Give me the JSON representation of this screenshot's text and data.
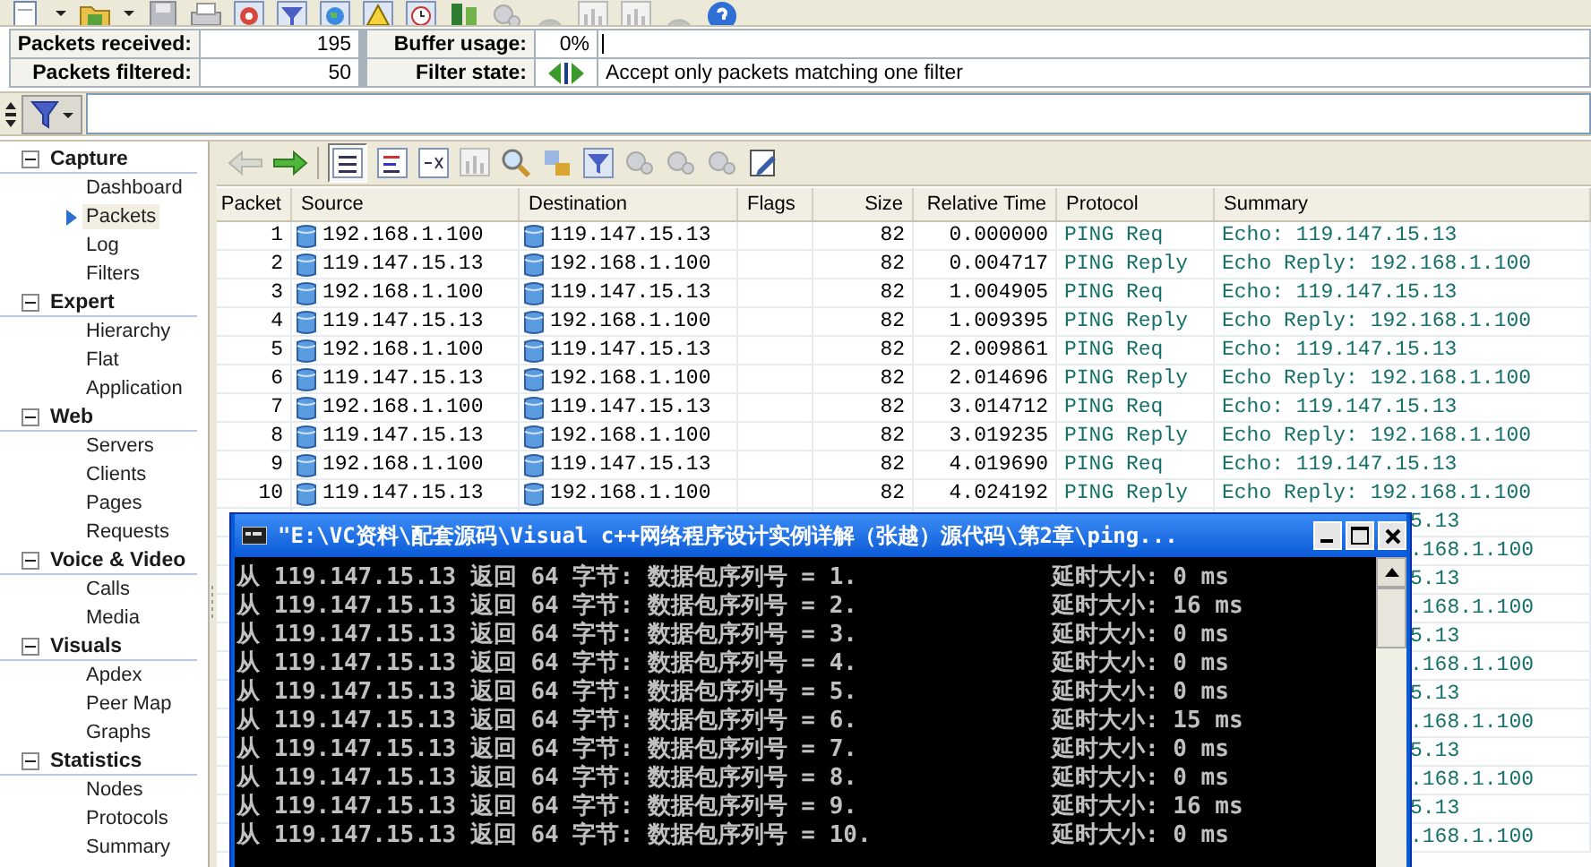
{
  "stats": {
    "received": {
      "label": "Packets received:",
      "value": "195"
    },
    "filtered": {
      "label": "Packets filtered:",
      "value": "50"
    },
    "buffer": {
      "label": "Buffer usage:",
      "value": "0%",
      "level": 0
    },
    "filter_state": {
      "label": "Filter state:",
      "text": "Accept only packets matching one filter"
    }
  },
  "sidebar": {
    "groups": [
      {
        "label": "Capture",
        "expanded": true,
        "children": [
          {
            "label": "Dashboard",
            "selected": false
          },
          {
            "label": "Packets",
            "selected": true
          },
          {
            "label": "Log",
            "selected": false
          },
          {
            "label": "Filters",
            "selected": false
          }
        ]
      },
      {
        "label": "Expert",
        "expanded": true,
        "children": [
          {
            "label": "Hierarchy",
            "selected": false
          },
          {
            "label": "Flat",
            "selected": false
          },
          {
            "label": "Application",
            "selected": false
          }
        ]
      },
      {
        "label": "Web",
        "expanded": true,
        "children": [
          {
            "label": "Servers",
            "selected": false
          },
          {
            "label": "Clients",
            "selected": false
          },
          {
            "label": "Pages",
            "selected": false
          },
          {
            "label": "Requests",
            "selected": false
          }
        ]
      },
      {
        "label": "Voice & Video",
        "expanded": true,
        "children": [
          {
            "label": "Calls",
            "selected": false
          },
          {
            "label": "Media",
            "selected": false
          }
        ]
      },
      {
        "label": "Visuals",
        "expanded": true,
        "children": [
          {
            "label": "Apdex",
            "selected": false
          },
          {
            "label": "Peer Map",
            "selected": false
          },
          {
            "label": "Graphs",
            "selected": false
          }
        ]
      },
      {
        "label": "Statistics",
        "expanded": true,
        "children": [
          {
            "label": "Nodes",
            "selected": false
          },
          {
            "label": "Protocols",
            "selected": false
          },
          {
            "label": "Summary",
            "selected": false
          }
        ]
      }
    ]
  },
  "packets": {
    "columns": [
      "Packet",
      "Source",
      "Destination",
      "Flags",
      "Size",
      "Relative Time",
      "Protocol",
      "Summary"
    ],
    "rows": [
      {
        "packet": "1",
        "source": "192.168.1.100",
        "destination": "119.147.15.13",
        "size": "82",
        "time": "0.000000",
        "protocol": "PING Req",
        "summary": "Echo: 119.147.15.13"
      },
      {
        "packet": "2",
        "source": "119.147.15.13",
        "destination": "192.168.1.100",
        "size": "82",
        "time": "0.004717",
        "protocol": "PING Reply",
        "summary": "Echo Reply: 192.168.1.100"
      },
      {
        "packet": "3",
        "source": "192.168.1.100",
        "destination": "119.147.15.13",
        "size": "82",
        "time": "1.004905",
        "protocol": "PING Req",
        "summary": "Echo: 119.147.15.13"
      },
      {
        "packet": "4",
        "source": "119.147.15.13",
        "destination": "192.168.1.100",
        "size": "82",
        "time": "1.009395",
        "protocol": "PING Reply",
        "summary": "Echo Reply: 192.168.1.100"
      },
      {
        "packet": "5",
        "source": "192.168.1.100",
        "destination": "119.147.15.13",
        "size": "82",
        "time": "2.009861",
        "protocol": "PING Req",
        "summary": "Echo: 119.147.15.13"
      },
      {
        "packet": "6",
        "source": "119.147.15.13",
        "destination": "192.168.1.100",
        "size": "82",
        "time": "2.014696",
        "protocol": "PING Reply",
        "summary": "Echo Reply: 192.168.1.100"
      },
      {
        "packet": "7",
        "source": "192.168.1.100",
        "destination": "119.147.15.13",
        "size": "82",
        "time": "3.014712",
        "protocol": "PING Req",
        "summary": "Echo: 119.147.15.13"
      },
      {
        "packet": "8",
        "source": "119.147.15.13",
        "destination": "192.168.1.100",
        "size": "82",
        "time": "3.019235",
        "protocol": "PING Reply",
        "summary": "Echo Reply: 192.168.1.100"
      },
      {
        "packet": "9",
        "source": "192.168.1.100",
        "destination": "119.147.15.13",
        "size": "82",
        "time": "4.019690",
        "protocol": "PING Req",
        "summary": "Echo: 119.147.15.13"
      },
      {
        "packet": "10",
        "source": "119.147.15.13",
        "destination": "192.168.1.100",
        "size": "82",
        "time": "4.024192",
        "protocol": "PING Reply",
        "summary": "Echo Reply: 192.168.1.100"
      },
      {
        "summary": "5.13"
      },
      {
        "summary": ".168.1.100"
      },
      {
        "summary": "5.13"
      },
      {
        "summary": ".168.1.100"
      },
      {
        "summary": "5.13"
      },
      {
        "summary": ".168.1.100"
      },
      {
        "summary": "5.13"
      },
      {
        "summary": ".168.1.100"
      },
      {
        "summary": "5.13"
      },
      {
        "summary": ".168.1.100"
      },
      {
        "summary": "5.13"
      },
      {
        "summary": ".168.1.100"
      }
    ]
  },
  "console": {
    "title": "\"E:\\VC资料\\配套源码\\Visual c++网络程序设计实例详解（张越）源代码\\第2章\\ping...",
    "lines": [
      {
        "text": "从 119.147.15.13 返回 64 字节: 数据包序列号 = 1.",
        "delay": "延时大小: 0 ms"
      },
      {
        "text": "从 119.147.15.13 返回 64 字节: 数据包序列号 = 2.",
        "delay": "延时大小: 16 ms"
      },
      {
        "text": "从 119.147.15.13 返回 64 字节: 数据包序列号 = 3.",
        "delay": "延时大小: 0 ms"
      },
      {
        "text": "从 119.147.15.13 返回 64 字节: 数据包序列号 = 4.",
        "delay": "延时大小: 0 ms"
      },
      {
        "text": "从 119.147.15.13 返回 64 字节: 数据包序列号 = 5.",
        "delay": "延时大小: 0 ms"
      },
      {
        "text": "从 119.147.15.13 返回 64 字节: 数据包序列号 = 6.",
        "delay": "延时大小: 15 ms"
      },
      {
        "text": "从 119.147.15.13 返回 64 字节: 数据包序列号 = 7.",
        "delay": "延时大小: 0 ms"
      },
      {
        "text": "从 119.147.15.13 返回 64 字节: 数据包序列号 = 8.",
        "delay": "延时大小: 0 ms"
      },
      {
        "text": "从 119.147.15.13 返回 64 字节: 数据包序列号 = 9.",
        "delay": "延时大小: 16 ms"
      },
      {
        "text": "从 119.147.15.13 返回 64 字节: 数据包序列号 = 10.",
        "delay": "延时大小: 0 ms"
      }
    ]
  }
}
